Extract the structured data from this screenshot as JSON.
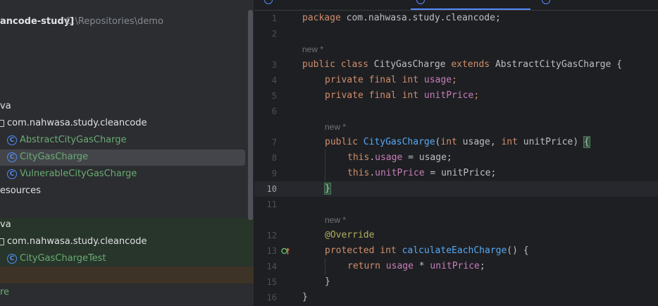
{
  "project": {
    "root_name": "ancode-study]",
    "root_path": "C:\\Repositories\\demo",
    "items": [
      {
        "label": "va"
      },
      {
        "label": "com.nahwasa.study.cleancode"
      },
      {
        "label": "AbstractCityGasCharge"
      },
      {
        "label": "CityGasCharge"
      },
      {
        "label": "VulnerableCityGasCharge"
      },
      {
        "label": "esources"
      },
      {
        "label": "va"
      },
      {
        "label": "com.nahwasa.study.cleancode"
      },
      {
        "label": "CityGasChargeTest"
      },
      {
        "label": "re"
      }
    ],
    "class_icon_letter": "C",
    "colors": {
      "class_name": "#6aab73",
      "selected_bg": "#43454a",
      "test_bg": "#28352a"
    }
  },
  "editor": {
    "hint": "new *",
    "line_numbers": [
      "1",
      "2",
      "3",
      "4",
      "5",
      "6",
      "7",
      "8",
      "9",
      "10",
      "11",
      "12",
      "13",
      "14",
      "15",
      "16"
    ],
    "code": {
      "l1_kw": "package",
      "l1_rest": " com.nahwasa.study.cleancode;",
      "l3_kw1": "public class",
      "l3_name": " CityGasCharge ",
      "l3_kw2": "extends",
      "l3_rest": " AbstractCityGasCharge {",
      "l4_kw": "private final int",
      "l4_field": "usage",
      "l4_end": ";",
      "l5_kw": "private final int",
      "l5_field": "unitPrice",
      "l5_end": ";",
      "l7_kw": "public",
      "l7_name": "CityGasCharge",
      "l7_p1": "(",
      "l7_int1": "int",
      "l7_a": " usage, ",
      "l7_int2": "int",
      "l7_b": " unitPrice) ",
      "l7_brace": "{",
      "l8_this": "this",
      "l8_dot": ".",
      "l8_field": "usage",
      "l8_rest": " = usage;",
      "l9_this": "this",
      "l9_dot": ".",
      "l9_field": "unitPrice",
      "l9_rest": " = unitPrice;",
      "l10_brace": "}",
      "l12_ann": "@Override",
      "l13_kw": "protected int",
      "l13_name": "calculateEachCharge",
      "l13_rest": "() {",
      "l14_kw": "return",
      "l14_f1": "usage",
      "l14_op": " * ",
      "l14_f2": "unitPrice",
      "l14_end": ";",
      "l15": "}",
      "l16": "}"
    },
    "gutter_icon": "override-method-icon",
    "accent": "#548af7"
  }
}
